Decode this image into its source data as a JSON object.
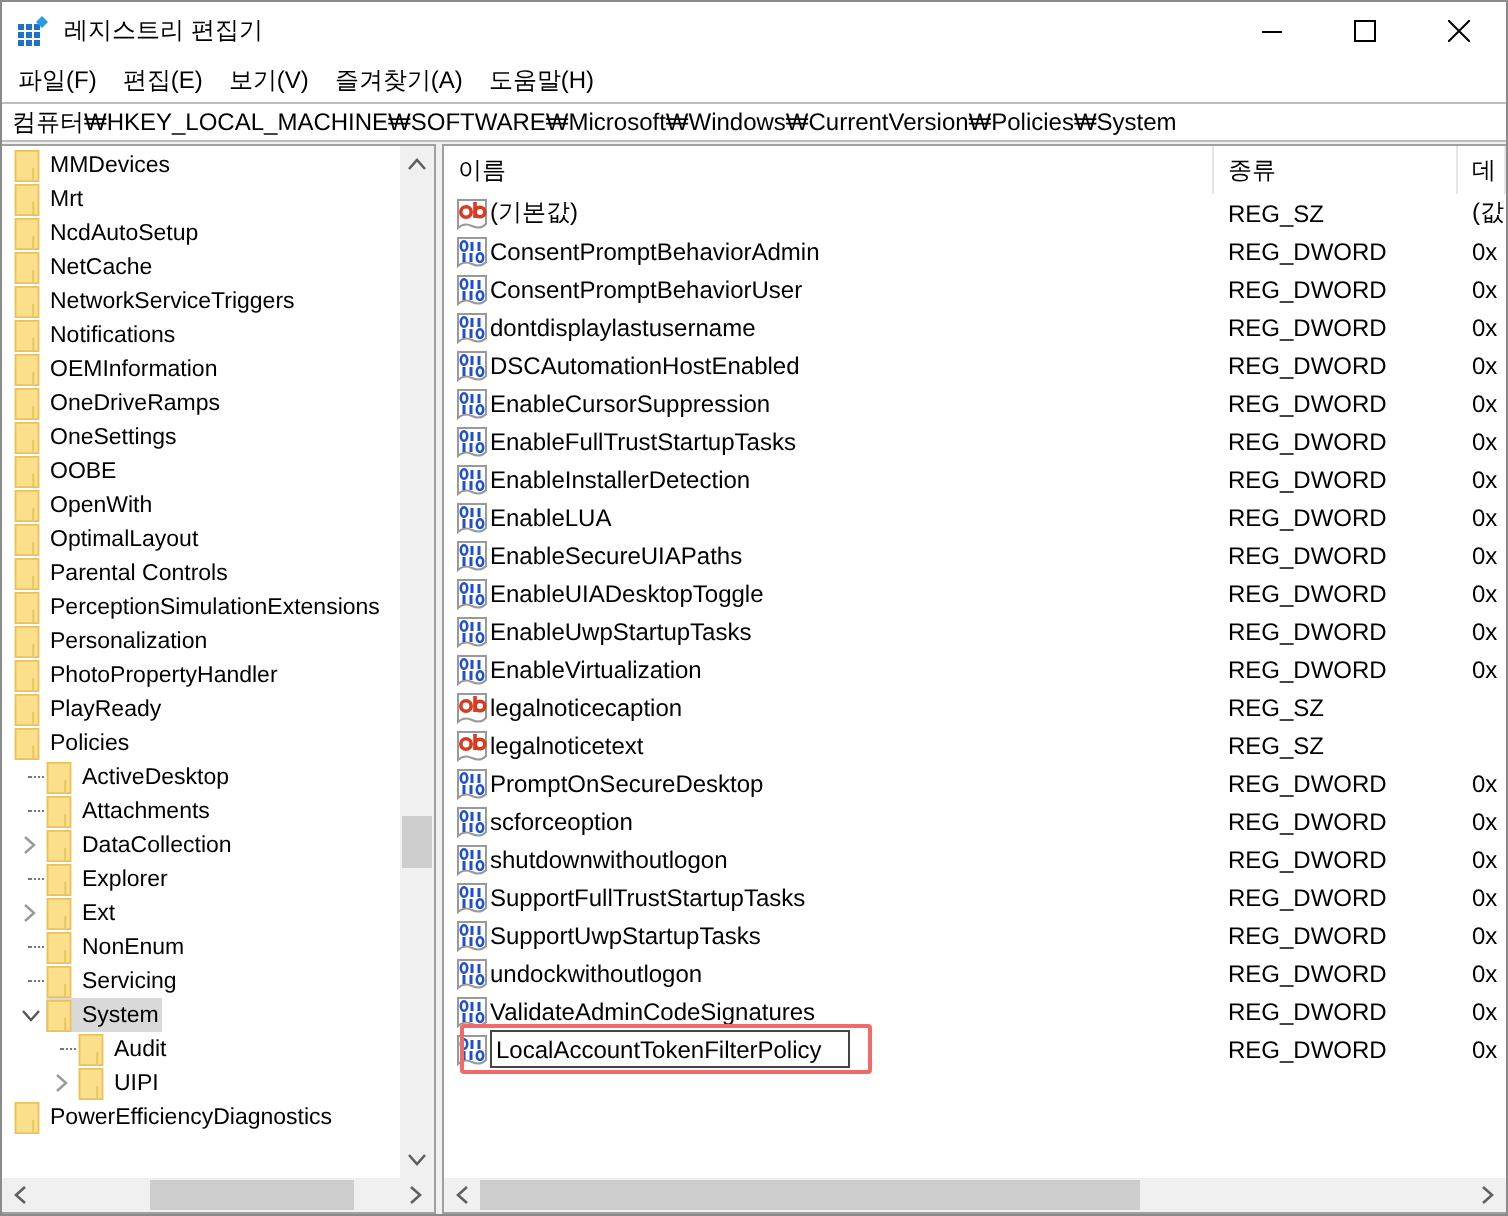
{
  "window": {
    "title": "레지스트리 편집기"
  },
  "menu": [
    "파일(F)",
    "편집(E)",
    "보기(V)",
    "즐겨찾기(A)",
    "도움말(H)"
  ],
  "address": "컴퓨터₩HKEY_LOCAL_MACHINE₩SOFTWARE₩Microsoft₩Windows₩CurrentVersion₩Policies₩System",
  "tree": {
    "items": [
      {
        "label": "MMDevices",
        "selected": false
      },
      {
        "label": "Mrt",
        "selected": false
      },
      {
        "label": "NcdAutoSetup",
        "selected": false
      },
      {
        "label": "NetCache",
        "selected": false
      },
      {
        "label": "NetworkServiceTriggers",
        "selected": false
      },
      {
        "label": "Notifications",
        "selected": false
      },
      {
        "label": "OEMInformation",
        "selected": false
      },
      {
        "label": "OneDriveRamps",
        "selected": false
      },
      {
        "label": "OneSettings",
        "selected": false
      },
      {
        "label": "OOBE",
        "selected": false
      },
      {
        "label": "OpenWith",
        "selected": false
      },
      {
        "label": "OptimalLayout",
        "selected": false
      },
      {
        "label": "Parental Controls",
        "selected": false
      },
      {
        "label": "PerceptionSimulationExtensions",
        "selected": false
      },
      {
        "label": "Personalization",
        "selected": false
      },
      {
        "label": "PhotoPropertyHandler",
        "selected": false
      },
      {
        "label": "PlayReady",
        "selected": false
      },
      {
        "label": "Policies",
        "selected": false,
        "children": [
          {
            "label": "ActiveDesktop",
            "selected": false
          },
          {
            "label": "Attachments",
            "selected": false
          },
          {
            "label": "DataCollection",
            "selected": false,
            "expanded": false
          },
          {
            "label": "Explorer",
            "selected": false
          },
          {
            "label": "Ext",
            "selected": false,
            "expanded": false
          },
          {
            "label": "NonEnum",
            "selected": false
          },
          {
            "label": "Servicing",
            "selected": false
          },
          {
            "label": "System",
            "selected": true,
            "expanded": true,
            "children": [
              {
                "label": "Audit",
                "selected": false
              },
              {
                "label": "UIPI",
                "selected": false,
                "expanded": false
              }
            ]
          }
        ]
      },
      {
        "label": "PowerEfficiencyDiagnostics",
        "selected": false
      }
    ]
  },
  "table": {
    "columns": [
      "이름",
      "종류",
      "데"
    ],
    "rows": [
      {
        "kind": "string",
        "name": "(기본값)",
        "type": "REG_SZ",
        "data": "(값"
      },
      {
        "kind": "dword",
        "name": "ConsentPromptBehaviorAdmin",
        "type": "REG_DWORD",
        "data": "0x"
      },
      {
        "kind": "dword",
        "name": "ConsentPromptBehaviorUser",
        "type": "REG_DWORD",
        "data": "0x"
      },
      {
        "kind": "dword",
        "name": "dontdisplaylastusername",
        "type": "REG_DWORD",
        "data": "0x"
      },
      {
        "kind": "dword",
        "name": "DSCAutomationHostEnabled",
        "type": "REG_DWORD",
        "data": "0x"
      },
      {
        "kind": "dword",
        "name": "EnableCursorSuppression",
        "type": "REG_DWORD",
        "data": "0x"
      },
      {
        "kind": "dword",
        "name": "EnableFullTrustStartupTasks",
        "type": "REG_DWORD",
        "data": "0x"
      },
      {
        "kind": "dword",
        "name": "EnableInstallerDetection",
        "type": "REG_DWORD",
        "data": "0x"
      },
      {
        "kind": "dword",
        "name": "EnableLUA",
        "type": "REG_DWORD",
        "data": "0x"
      },
      {
        "kind": "dword",
        "name": "EnableSecureUIAPaths",
        "type": "REG_DWORD",
        "data": "0x"
      },
      {
        "kind": "dword",
        "name": "EnableUIADesktopToggle",
        "type": "REG_DWORD",
        "data": "0x"
      },
      {
        "kind": "dword",
        "name": "EnableUwpStartupTasks",
        "type": "REG_DWORD",
        "data": "0x"
      },
      {
        "kind": "dword",
        "name": "EnableVirtualization",
        "type": "REG_DWORD",
        "data": "0x"
      },
      {
        "kind": "string",
        "name": "legalnoticecaption",
        "type": "REG_SZ"
      },
      {
        "kind": "string",
        "name": "legalnoticetext",
        "type": "REG_SZ"
      },
      {
        "kind": "dword",
        "name": "PromptOnSecureDesktop",
        "type": "REG_DWORD",
        "data": "0x"
      },
      {
        "kind": "dword",
        "name": "scforceoption",
        "type": "REG_DWORD",
        "data": "0x"
      },
      {
        "kind": "dword",
        "name": "shutdownwithoutlogon",
        "type": "REG_DWORD",
        "data": "0x"
      },
      {
        "kind": "dword",
        "name": "SupportFullTrustStartupTasks",
        "type": "REG_DWORD",
        "data": "0x"
      },
      {
        "kind": "dword",
        "name": "SupportUwpStartupTasks",
        "type": "REG_DWORD",
        "data": "0x"
      },
      {
        "kind": "dword",
        "name": "undockwithoutlogon",
        "type": "REG_DWORD",
        "data": "0x"
      },
      {
        "kind": "dword",
        "name": "ValidateAdminCodeSignatures",
        "type": "REG_DWORD",
        "data": "0x"
      },
      {
        "kind": "dword",
        "name": "LocalAccountTokenFilterPolicy",
        "type": "REG_DWORD",
        "data": "0x",
        "editing": true,
        "highlighted": true
      }
    ]
  }
}
